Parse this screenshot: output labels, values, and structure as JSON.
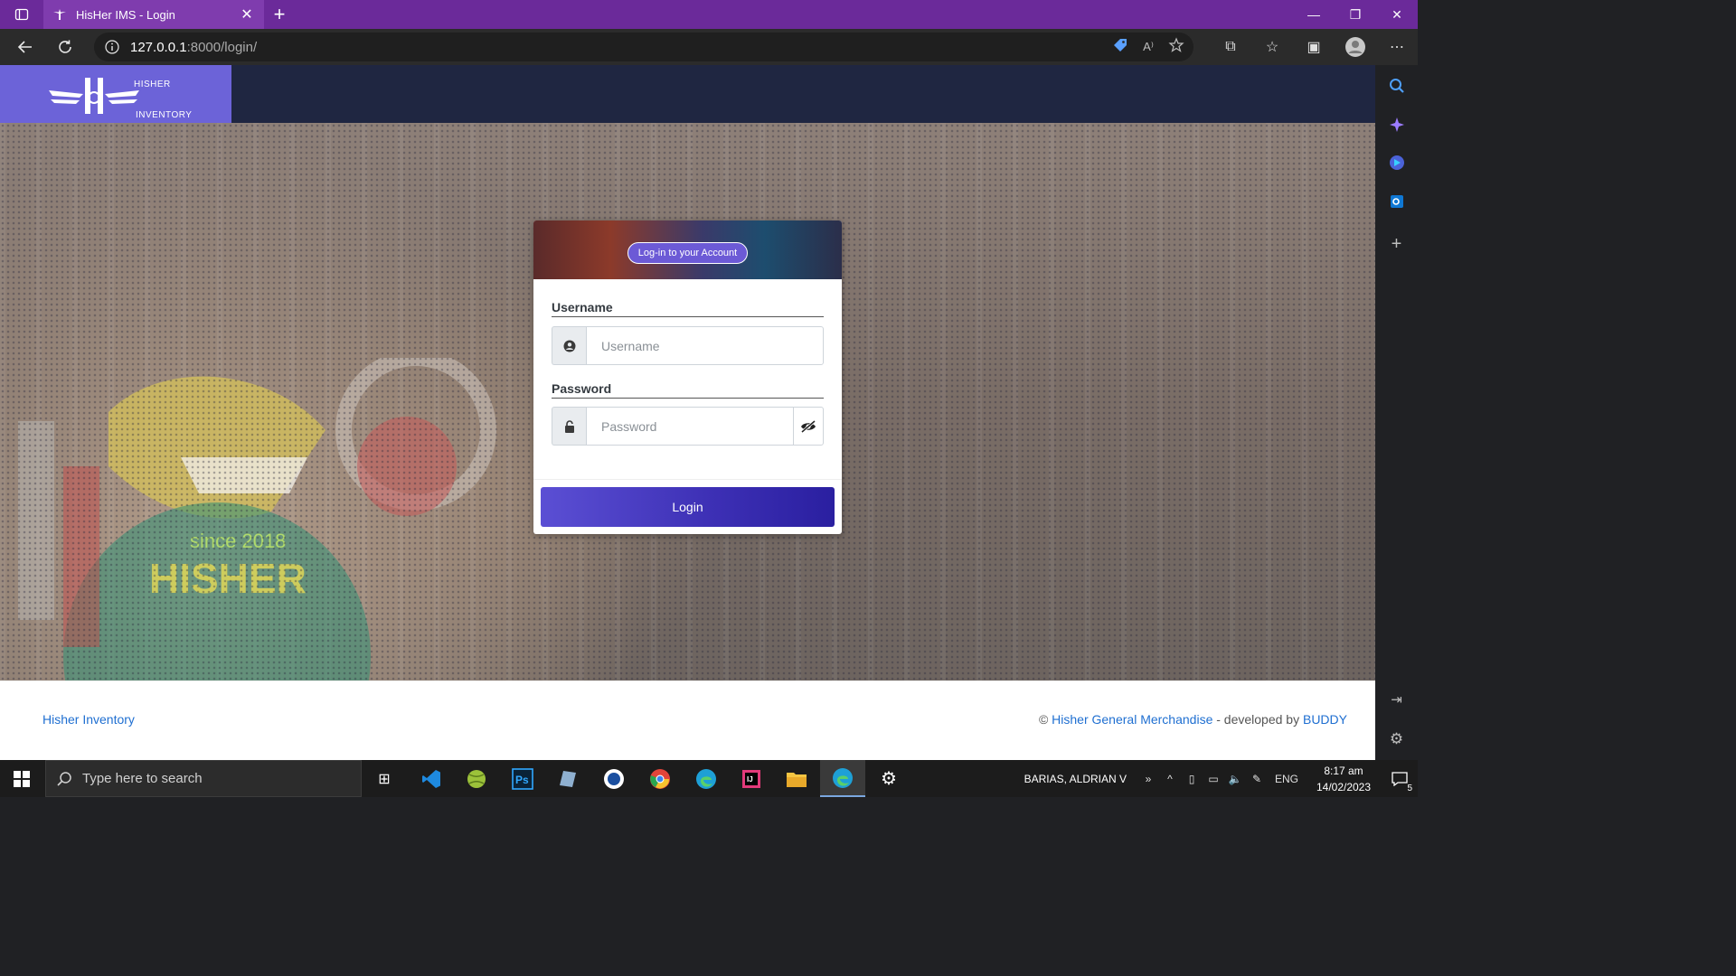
{
  "browser": {
    "tab_title": "HisHer IMS - Login",
    "url_host": "127.0.0.1",
    "url_path": ":8000/login/",
    "accent": "#6b2a9a"
  },
  "header": {
    "brand_top": "HISHER",
    "brand_bottom": "INVENTORY"
  },
  "login": {
    "banner": "Log-in to your Account",
    "username_label": "Username",
    "username_placeholder": "Username",
    "password_label": "Password",
    "password_placeholder": "Password",
    "submit": "Login",
    "button_color": "#3c2fb4"
  },
  "footer": {
    "left": "Hisher Inventory",
    "copyright": "©",
    "company": "Hisher General Merchandise",
    "developed_by": " - developed by ",
    "developer": "BUDDY"
  },
  "taskbar": {
    "search_placeholder": "Type here to search",
    "user": "BARIAS, ALDRIAN V",
    "lang": "ENG",
    "time": "8:17 am",
    "date": "14/02/2023",
    "notif_count": "5"
  }
}
